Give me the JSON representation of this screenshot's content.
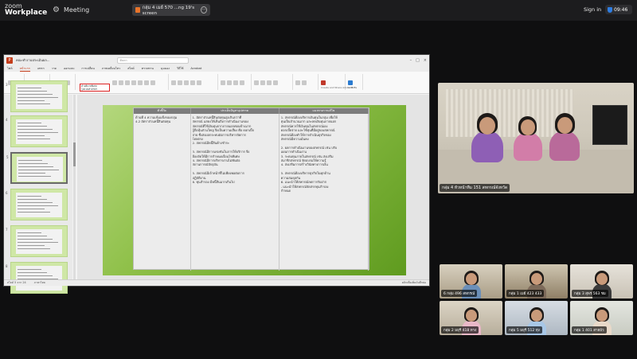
{
  "topbar": {
    "logo_line1": "zoom",
    "logo_line2": "Workplace",
    "meeting_label": "Meeting",
    "share_label": "กลุ่ม 4 เมย์ 570 ...ng 19's screen",
    "signin_label": "Sign in",
    "clock": "09:46"
  },
  "ppt": {
    "title": "คณะทำงานประเมินผล...",
    "search_placeholder": "ค้นหา",
    "menus": [
      "ไฟล์",
      "หน้าแรก",
      "แทรก",
      "วาด",
      "ออกแบบ",
      "การเปลี่ยน",
      "ภาพเคลื่อนไหว",
      "สไลด์",
      "ตรวจทาน",
      "มุมมอง",
      "วิธีใช้",
      "Acrobat"
    ],
    "active_menu": "หน้าแรก",
    "ribbon_right": [
      "Create and Share Adobe PDF",
      "Add-ins"
    ],
    "font_box_line1": "คำอธิบายพิเศษ",
    "font_box_line2": "รูปแบบตัวอักษร",
    "status_left": "สไลด์ 5 จาก 24",
    "status_mid": "ภาษาไทย",
    "status_right": "คลิกเพื่อเพิ่มบันทึกย่อ",
    "slide_numbers": [
      "3",
      "4",
      "5",
      "6",
      "7",
      "8"
    ],
    "slide_table": {
      "headers": [
        "ตัวชี้วัด",
        "ประเด็นปัญหาอุปสรรค",
        "แนวทางการแก้ไข"
      ],
      "col1": [
        "ด้านที่ 4 ความเข้มแข็งของกลุ่ม",
        "4.2 อัตราส่วนหนี้สินต่อทุน"
      ],
      "col2": [
        "1. อัตราส่วนหนี้สินต่อทุนสูงเกินกว่าที่",
        "สหกรณ์ แสดงให้เห็นถึงการดำเนินงานของ",
        "สหกรณ์ที่ใช้เงินทุนจากภายนอกค่อนข้างมาก",
        "ผู้ถือหุ้นส่วนใหญ่ จึงเป็นความเสี่ยง คือ ดอกเบี้ย",
        "จ่าย ซึ่งส่งผลกระทบต่อการบริหารจัดการ",
        "โดยตรง",
        "2. สหกรณ์มีหนี้สินค้างชำระ",
        "",
        "3. สหกรณ์มีการแข่งขันในการให้บริการ จึง",
        "ต้องจัดให้มีการกำหนดเงื่อนไขพิเศษ",
        "4. สหกรณ์มีการบริหารงานไม่ทันต่อ",
        "สถานการณ์ปัจจุบัน",
        "",
        "5. สหกรณ์มีเจ้าหน้าที่ไม่เพียงพอต่อการ",
        "ปฏิบัติงาน",
        "6. ทุนสำรอง มีหนี้สินมากเกินไป"
      ],
      "col3": [
        "1. สหกรณ์ต้องบริหารเงินทุนในกลุ่ม เพื่อให้",
        "ทุนเป็นจำนวนมาก และลดเงินทุนภายนอก",
        "สหกรณ์ควรใช้เงินทุนในสหกรณ์เอง",
        "ดอกเบี้ยจ่าย และใช้ทุนที่มีอยู่ของสหกรณ์",
        "สหกรณ์ต้องทำให้การดำเนินธุรกิจของ",
        "สหกรณ์มีความมั่นคง",
        "",
        "2. ผลการดำเนินงานของสหกรณ์ เช่น ปรับ",
        "แผนการดำเนินงาน",
        "3. ระดมทุนภายในสหกรณ์ เช่น ส่งเสริม",
        "สมาชิกสหกรณ์ จัดอบรมให้ความรู้",
        "4. ส่งเสริมการสร้างวินัยทางการเงิน",
        "",
        "5. สหกรณ์ต้องบริหารธุรกิจในทุกด้าน",
        "ความสมดุลกัน",
        "6. แนะนำให้สหกรณ์ลดการรับฝาก",
        "- แนะนำให้สหกรณ์จัดสรรทุนสำรอง",
        "กำหนด"
      ]
    }
  },
  "videos": {
    "main_name": "กลุ่ม 4 หัวหน้าทีม 151 สหกรณ์จังหวัด",
    "tiles": [
      "6 กลุ่ม 496 สหกรณ์",
      "กลุ่ม 1 เมย์ 423 433",
      "กลุ่ม 3 สุพร 563 ชม",
      "กลุ่ม 2 มยุรี 418 ทาง",
      "กลุ่ม 5 มยุรี 512 ทุ่ง",
      "กลุ่ม 1 401 สายบัว"
    ]
  }
}
